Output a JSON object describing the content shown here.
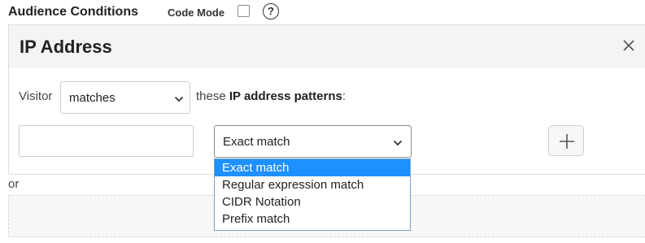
{
  "header": {
    "title": "Audience Conditions",
    "code_mode_label": "Code Mode",
    "code_mode_checked": false,
    "help_symbol": "?"
  },
  "condition": {
    "title": "IP Address",
    "close_icon": "close-icon",
    "visitor_label": "Visitor",
    "operator": "matches",
    "these_text": "these ",
    "patterns_bold": "IP address patterns",
    "colon": ":",
    "ip_input_value": "",
    "match_type": "Exact match",
    "add_icon": "plus-icon"
  },
  "dropdown": {
    "options": [
      "Exact match",
      "Regular expression match",
      "CIDR Notation",
      "Prefix match"
    ],
    "highlighted_index": 0
  },
  "or_label": "or",
  "colors": {
    "highlight": "#1e90ff",
    "header_bg": "#f4f4f4"
  }
}
